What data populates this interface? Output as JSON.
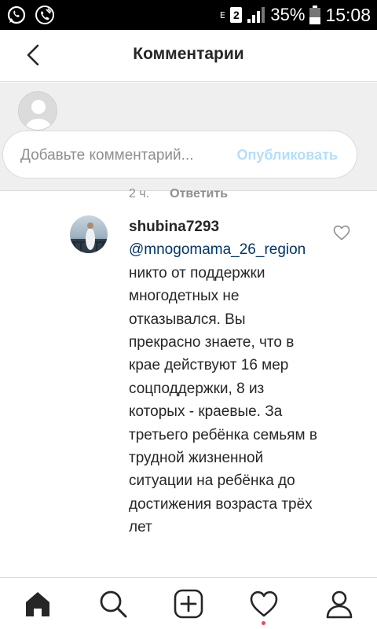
{
  "status_bar": {
    "left_icons": [
      "whatsapp-icon",
      "phone-icon"
    ],
    "network_type": "E",
    "sim": "2",
    "battery_percent": "35%",
    "time": "15:08"
  },
  "header": {
    "back_icon": "arrow-left-icon",
    "title": "Комментарии"
  },
  "composer": {
    "placeholder": "Добавьте комментарий...",
    "publish_label": "Опубликовать"
  },
  "previous_comment_meta": {
    "time": "2 ч.",
    "reply_label": "Ответить"
  },
  "comment": {
    "username": "shubina7293",
    "mention": "@mnogomama_26_region",
    "text": "никто от поддержки многодетных не отказывался. Вы прекрасно знаете, что в крае действуют 16 мер соцподдержки, 8 из которых - краевые. За третьего ребёнка семьям в трудной жизненной ситуации на ребёнка до достижения возраста трёх лет",
    "like_icon": "heart-outline-icon"
  },
  "bottom_nav": {
    "items": [
      "home-icon",
      "search-icon",
      "add-post-icon",
      "activity-heart-icon",
      "profile-icon"
    ],
    "notification_dot_color": "#ed4956"
  },
  "colors": {
    "publish_disabled": "#b2dffc",
    "mention": "#003569",
    "muted": "#8e8e8e",
    "text": "#262626"
  }
}
